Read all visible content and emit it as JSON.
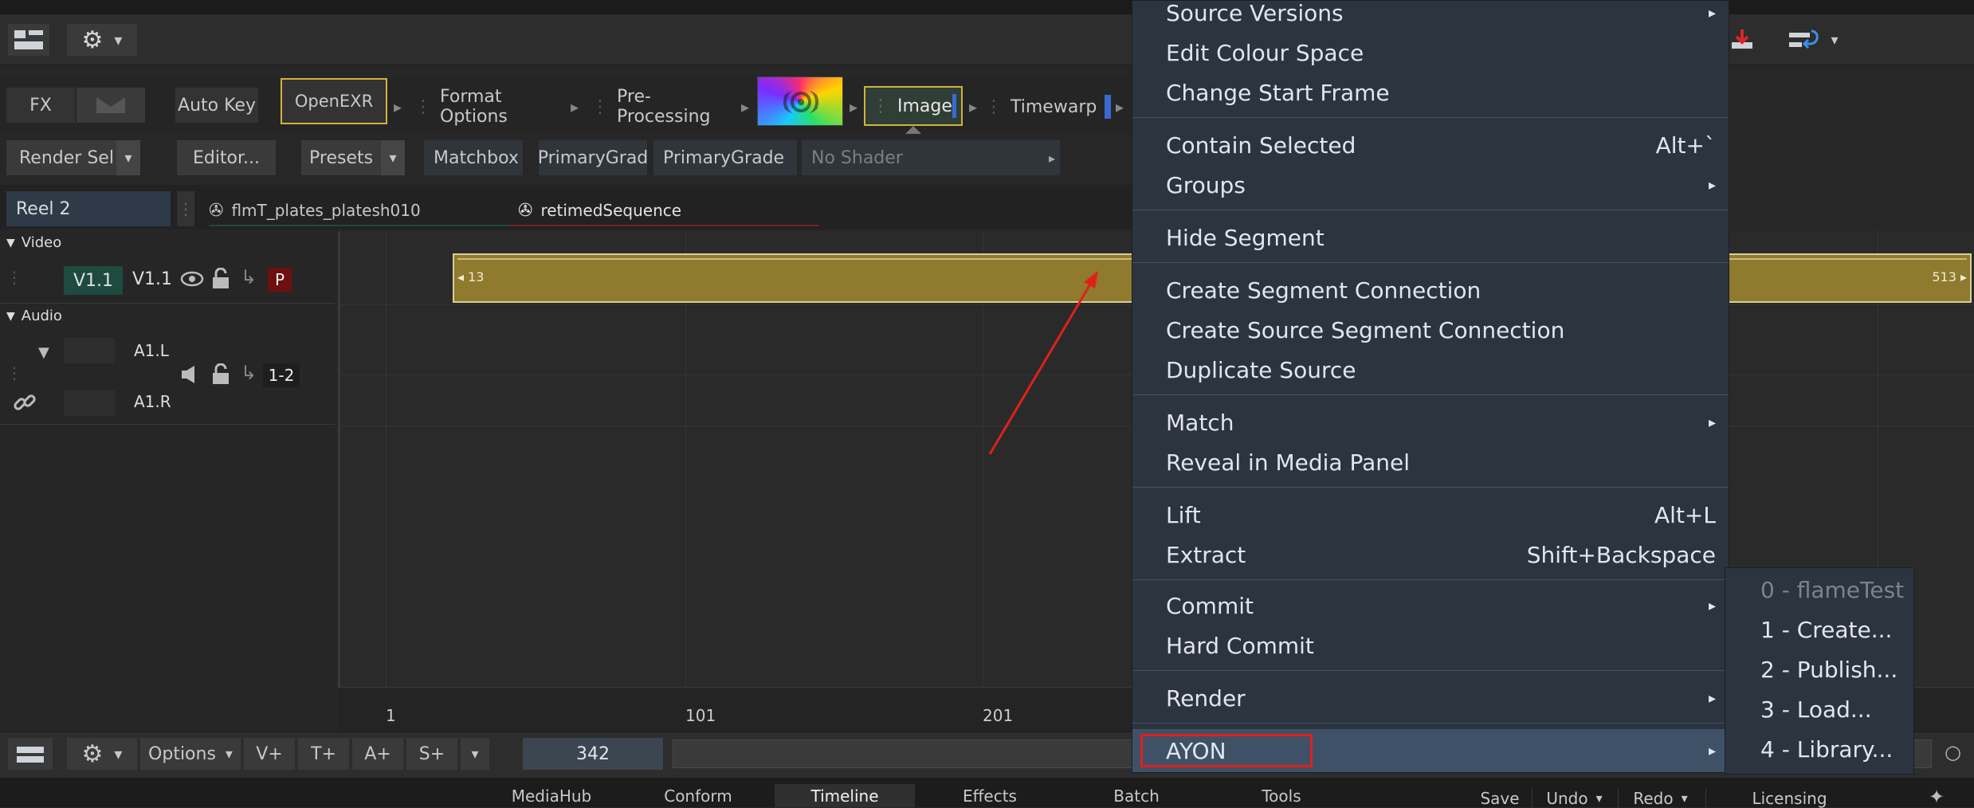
{
  "top_toolbar": {
    "gear_label": "⚙",
    "caret": "▾"
  },
  "fx_row": {
    "fx_label": "FX",
    "auto_key_label": "Auto Key",
    "nodes": [
      "OpenEXR",
      "Format Options",
      "Pre-Processing",
      "Image",
      "Timewarp"
    ]
  },
  "shader_row": {
    "render_sel_label": "Render Sel",
    "editor_label": "Editor...",
    "presets_label": "Presets",
    "matchbox_label": "Matchbox",
    "primarygrad_label": "PrimaryGrad",
    "primarygrade_label": "PrimaryGrade",
    "no_shader_label": "No Shader"
  },
  "reel_row": {
    "reel_name": "Reel 2",
    "tab1": "flmT_plates_platesh010",
    "tab2": "retimedSequence"
  },
  "tracks": {
    "video_label": "Video",
    "v_track_a": "V1.1",
    "v_track_b": "V1.1",
    "priority_badge": "P",
    "audio_label": "Audio",
    "a_left": "A1.L",
    "a_right": "A1.R",
    "a_channels": "1-2"
  },
  "clip": {
    "start_frame": "13",
    "end_frame": "513",
    "color": "#8f7a2e"
  },
  "ruler": {
    "ticks": [
      "1",
      "101",
      "201"
    ]
  },
  "bottom_bar": {
    "options_label": "Options",
    "v_plus": "V+",
    "t_plus": "T+",
    "a_plus": "A+",
    "s_plus": "S+",
    "frame_value": "342"
  },
  "tabs": {
    "items": [
      "MediaHub",
      "Conform",
      "Timeline",
      "Effects",
      "Batch",
      "Tools"
    ],
    "active": "Timeline",
    "save_label": "Save",
    "undo_label": "Undo",
    "redo_label": "Redo",
    "licensing_label": "Licensing"
  },
  "context_menu": {
    "items": [
      {
        "label": "Source Versions",
        "submenu": true
      },
      {
        "label": "Edit Colour Space"
      },
      {
        "label": "Change Start Frame"
      },
      {
        "label": "Contain Selected",
        "shortcut": "Alt+`"
      },
      {
        "label": "Groups",
        "submenu": true
      },
      {
        "label": "Hide Segment"
      },
      {
        "label": "Create Segment Connection"
      },
      {
        "label": "Create Source Segment Connection"
      },
      {
        "label": "Duplicate Source"
      },
      {
        "label": "Match",
        "submenu": true
      },
      {
        "label": "Reveal in Media Panel"
      },
      {
        "label": "Lift",
        "shortcut": "Alt+L"
      },
      {
        "label": "Extract",
        "shortcut": "Shift+Backspace"
      },
      {
        "label": "Commit",
        "submenu": true
      },
      {
        "label": "Hard Commit"
      },
      {
        "label": "Render",
        "submenu": true
      },
      {
        "label": "AYON",
        "submenu": true,
        "highlighted": true
      }
    ]
  },
  "ayon_submenu": {
    "items": [
      {
        "label": "0 - flameTest",
        "disabled": true
      },
      {
        "label": "1 - Create..."
      },
      {
        "label": "2 - Publish..."
      },
      {
        "label": "3 - Load..."
      },
      {
        "label": "4 - Library..."
      }
    ]
  },
  "colors": {
    "menu_bg": "#2c3440",
    "menu_highlight": "#3f5166",
    "annotation_red": "#e0201c",
    "selected_node_border": "#d2b33a"
  }
}
